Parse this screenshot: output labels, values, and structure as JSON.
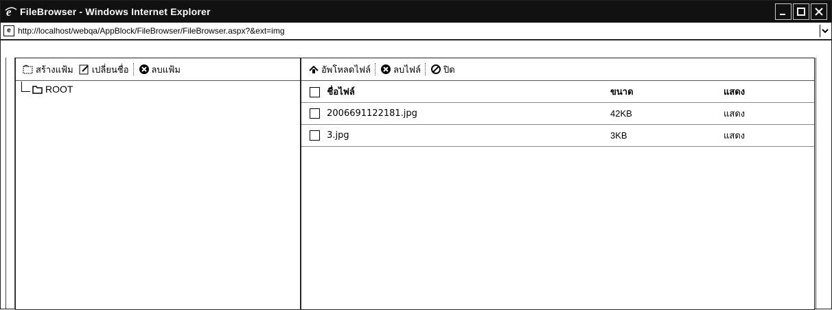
{
  "window": {
    "title": "FileBrowser - Windows Internet Explorer",
    "url": "http://localhost/webqa/AppBlock/FileBrowser/FileBrowser.aspx?&ext=img"
  },
  "folder_toolbar": {
    "create_folder": "สร้างแฟ้ม",
    "rename": "เปลี่ยนชื่อ",
    "delete_folder": "ลบแฟ้ม"
  },
  "tree": {
    "root_label": "ROOT"
  },
  "file_toolbar": {
    "upload": "อัพโหลดไฟล์",
    "delete_file": "ลบไฟล์",
    "close": "ปิด"
  },
  "file_table": {
    "headers": {
      "name": "ชื่อไฟล์",
      "size": "ขนาด",
      "view": "แสดง"
    },
    "rows": [
      {
        "name": "2006691122181.jpg",
        "size": "42KB",
        "view": "แสดง"
      },
      {
        "name": "3.jpg",
        "size": "3KB",
        "view": "แสดง"
      }
    ]
  },
  "icons": {
    "browser": "ie-logo-icon",
    "create_folder": "new-folder-icon",
    "rename": "rename-icon",
    "delete": "delete-x-icon",
    "upload": "upload-icon",
    "close": "cancel-icon",
    "folder": "folder-icon"
  }
}
